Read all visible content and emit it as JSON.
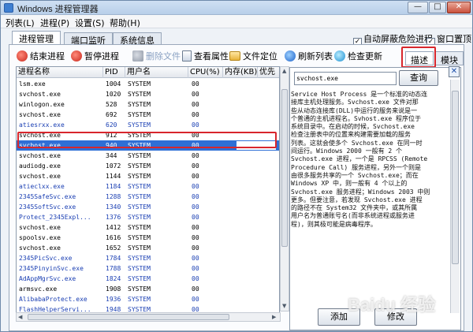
{
  "window": {
    "title": "Windows 进程管理器",
    "controls": [
      "—",
      "□",
      "✕"
    ]
  },
  "menu": [
    {
      "label": "列表(L)"
    },
    {
      "label": "进程(P)"
    },
    {
      "label": "设置(S)"
    },
    {
      "label": "帮助(H)"
    }
  ],
  "tabs": [
    {
      "label": "进程管理"
    },
    {
      "label": "端口监听"
    },
    {
      "label": "系统信息"
    }
  ],
  "options": {
    "auto_block_label": "自动屏蔽危险进程",
    "always_on_top_label": "窗口置顶",
    "check_mark": "✓"
  },
  "toolbar": [
    {
      "label": "结束进程",
      "icon": "end-process-icon"
    },
    {
      "label": "暂停进程",
      "icon": "pause-process-icon"
    },
    {
      "label": "删除文件",
      "icon": "delete-file-icon",
      "disabled": true
    },
    {
      "label": "查看属性",
      "icon": "properties-icon"
    },
    {
      "label": "文件定位",
      "icon": "locate-file-icon"
    },
    {
      "label": "刷新列表",
      "icon": "refresh-icon"
    },
    {
      "label": "检查更新",
      "icon": "update-icon"
    }
  ],
  "side_tabs": [
    {
      "label": "描述"
    },
    {
      "label": "模块"
    }
  ],
  "process_table": {
    "columns": [
      "进程名称",
      "PID",
      "用户名",
      "CPU(%)",
      "内存(KB)",
      "优先"
    ],
    "rows": [
      {
        "name": "lsm.exe",
        "pid": "1004",
        "user": "SYSTEM",
        "cpu": "00",
        "link": false
      },
      {
        "name": "svchost.exe",
        "pid": "1020",
        "user": "SYSTEM",
        "cpu": "00",
        "link": false
      },
      {
        "name": "winlogon.exe",
        "pid": "528",
        "user": "SYSTEM",
        "cpu": "00",
        "link": false
      },
      {
        "name": "svchost.exe",
        "pid": "692",
        "user": "SYSTEM",
        "cpu": "00",
        "link": false
      },
      {
        "name": "atiesrxx.exe",
        "pid": "620",
        "user": "SYSTEM",
        "cpu": "00",
        "link": true
      },
      {
        "name": "svchost.exe",
        "pid": "912",
        "user": "SYSTEM",
        "cpu": "00",
        "link": false
      },
      {
        "name": "svchost.exe",
        "pid": "940",
        "user": "SYSTEM",
        "cpu": "00",
        "link": false,
        "selected": true
      },
      {
        "name": "svchost.exe",
        "pid": "344",
        "user": "SYSTEM",
        "cpu": "00",
        "link": false
      },
      {
        "name": "audiodg.exe",
        "pid": "1072",
        "user": "SYSTEM",
        "cpu": "00",
        "link": false
      },
      {
        "name": "svchost.exe",
        "pid": "1144",
        "user": "SYSTEM",
        "cpu": "00",
        "link": false
      },
      {
        "name": "atieclxx.exe",
        "pid": "1184",
        "user": "SYSTEM",
        "cpu": "00",
        "link": true
      },
      {
        "name": "2345SafeSvc.exe",
        "pid": "1288",
        "user": "SYSTEM",
        "cpu": "00",
        "link": true
      },
      {
        "name": "2345SoftSvc.exe",
        "pid": "1340",
        "user": "SYSTEM",
        "cpu": "00",
        "link": true
      },
      {
        "name": "Protect_2345Expl...",
        "pid": "1376",
        "user": "SYSTEM",
        "cpu": "00",
        "link": true
      },
      {
        "name": "svchost.exe",
        "pid": "1412",
        "user": "SYSTEM",
        "cpu": "00",
        "link": false
      },
      {
        "name": "spoolsv.exe",
        "pid": "1616",
        "user": "SYSTEM",
        "cpu": "00",
        "link": false
      },
      {
        "name": "svchost.exe",
        "pid": "1652",
        "user": "SYSTEM",
        "cpu": "00",
        "link": false
      },
      {
        "name": "2345PicSvc.exe",
        "pid": "1784",
        "user": "SYSTEM",
        "cpu": "00",
        "link": true
      },
      {
        "name": "2345PinyinSvc.exe",
        "pid": "1788",
        "user": "SYSTEM",
        "cpu": "00",
        "link": true
      },
      {
        "name": "AdAppMgrSvc.exe",
        "pid": "1824",
        "user": "SYSTEM",
        "cpu": "00",
        "link": true
      },
      {
        "name": "armsvc.exe",
        "pid": "1908",
        "user": "SYSTEM",
        "cpu": "00",
        "link": false
      },
      {
        "name": "AlibabaProtect.exe",
        "pid": "1936",
        "user": "SYSTEM",
        "cpu": "00",
        "link": true
      },
      {
        "name": "FlashHelperServi...",
        "pid": "1948",
        "user": "SYSTEM",
        "cpu": "00",
        "link": true
      }
    ]
  },
  "details": {
    "search_value": "svchost.exe",
    "query_label": "查询",
    "close_label": "✕",
    "description_lines": [
      "Service Host Process 是一个标准的动态连",
      "接库主机处理服务。Svchost.exe 文件对那",
      "些从动态连接库(DLL)中运行的服务来说是一",
      "个普通的主机进程名。Svhost.exe 程序位于",
      "系统目录中。在启动的时候，Svchost.exe",
      "检查注册表中的位置来构建需要加载的服务",
      "列表。这就会使多个 Svchost.exe 在同一时",
      "间运行。Windows 2000 一般有 2 个",
      "Svchost.exe 进程，一个是 RPCSS (Remote",
      "Procedure Call) 服务进程，另外一个则是",
      "由很多服务共享的一个 Svchost.exe；而在",
      "Windows XP 中，则一般有 4 个以上的",
      "Svchost.exe 服务进程；Windows 2003 中则",
      "更多。但要注意，若发现 Svchost.exe 进程",
      "的路径不在 System32 文件夹中，或其所属",
      "用户名为普通账号名(而非系统进程或服务进",
      "程)，则其极可能是病毒程序。"
    ],
    "add_label": "添加",
    "edit_label": "修改"
  },
  "watermark": "Baidu 经验"
}
